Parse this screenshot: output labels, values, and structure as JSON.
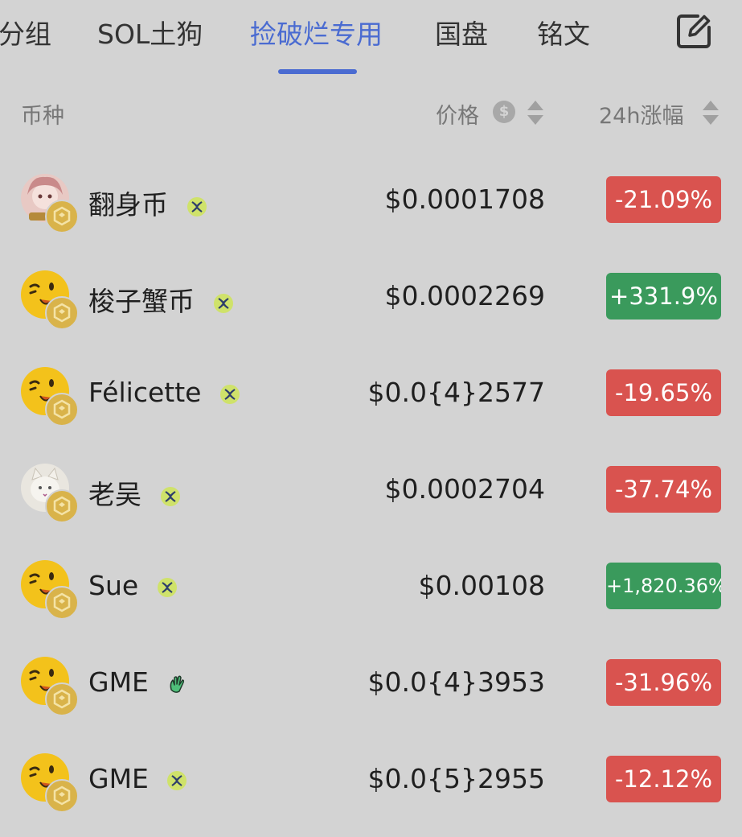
{
  "tabs": [
    {
      "label": "分组",
      "active": false
    },
    {
      "label": "SOL土狗",
      "active": false
    },
    {
      "label": "捡破烂专用",
      "active": true
    },
    {
      "label": "国盘",
      "active": false
    },
    {
      "label": "铭文",
      "active": false
    }
  ],
  "edit_icon": "edit-icon",
  "header": {
    "coin_col": "币种",
    "price_col": "价格",
    "change_col": "24h涨幅",
    "currency_symbol": "$"
  },
  "colors": {
    "accent": "#4a6bd1",
    "negative": "#d9534f",
    "positive": "#3a9a5c",
    "background": "#d3d3d3"
  },
  "rows": [
    {
      "name": "翻身币",
      "avatar": "anime-girl-avatar",
      "tag_icon": "butterfly-icon",
      "price": "$0.0001708",
      "change": "-21.09%",
      "direction": "down"
    },
    {
      "name": "梭子蟹币",
      "avatar": "winking-emoji-avatar",
      "tag_icon": "butterfly-icon",
      "price": "$0.0002269",
      "change": "+331.9%",
      "direction": "up"
    },
    {
      "name": "Félicette",
      "avatar": "winking-emoji-avatar",
      "tag_icon": "butterfly-icon",
      "price": "$0.0{4}2577",
      "change": "-19.65%",
      "direction": "down"
    },
    {
      "name": "老吴",
      "avatar": "cat-photo-avatar",
      "tag_icon": "butterfly-icon",
      "price": "$0.0002704",
      "change": "-37.74%",
      "direction": "down"
    },
    {
      "name": "Sue",
      "avatar": "winking-emoji-avatar",
      "tag_icon": "butterfly-icon",
      "price": "$0.00108",
      "change": "+1,820.36%",
      "direction": "up"
    },
    {
      "name": "GME",
      "avatar": "winking-emoji-avatar",
      "tag_icon": "wave-hand-icon",
      "price": "$0.0{4}3953",
      "change": "-31.96%",
      "direction": "down"
    },
    {
      "name": "GME",
      "avatar": "winking-emoji-avatar",
      "tag_icon": "butterfly-icon",
      "price": "$0.0{5}2955",
      "change": "-12.12%",
      "direction": "down"
    }
  ]
}
